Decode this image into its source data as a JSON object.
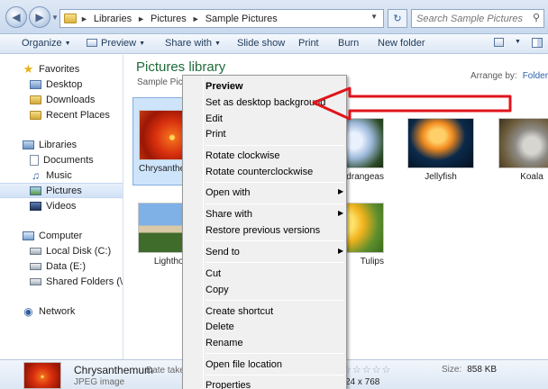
{
  "address": {
    "crumbs": [
      "Libraries",
      "Pictures",
      "Sample Pictures"
    ],
    "search_placeholder": "Search Sample Pictures"
  },
  "toolbar": {
    "organize": "Organize",
    "preview": "Preview",
    "share_with": "Share with",
    "slide_show": "Slide show",
    "print": "Print",
    "burn": "Burn",
    "new_folder": "New folder"
  },
  "nav": {
    "favorites": "Favorites",
    "desktop": "Desktop",
    "downloads": "Downloads",
    "recent_places": "Recent Places",
    "libraries": "Libraries",
    "documents": "Documents",
    "music": "Music",
    "pictures": "Pictures",
    "videos": "Videos",
    "computer": "Computer",
    "local_disk": "Local Disk (C:)",
    "data": "Data (E:)",
    "shared_folders": "Shared Folders (\\\\vn",
    "network": "Network"
  },
  "library": {
    "title": "Pictures library",
    "subtitle": "Sample Pict",
    "arrange_label": "Arrange by:",
    "arrange_value": "Folder"
  },
  "thumbnails": [
    {
      "caption": "Chrysanthe"
    },
    {
      "caption": "ydrangeas"
    },
    {
      "caption": "Jellyfish"
    },
    {
      "caption": "Koala"
    },
    {
      "caption": "Lighthou"
    },
    {
      "caption": "Tulips"
    }
  ],
  "context_menu": {
    "items": [
      "Preview",
      "Set as desktop background",
      "Edit",
      "Print",
      "Rotate clockwise",
      "Rotate counterclockwise",
      "Open with",
      "Share with",
      "Restore previous versions",
      "Send to",
      "Cut",
      "Copy",
      "Create shortcut",
      "Delete",
      "Rename",
      "Open file location",
      "Properties"
    ]
  },
  "details": {
    "name": "Chrysanthemum",
    "type": "JPEG image",
    "date_label": "Date take",
    "dimensions": "24 x 768",
    "size_label": "Size:",
    "size_value": "858 KB",
    "rating": 0
  },
  "annotation": {
    "arrow_color": "#e0141b"
  }
}
